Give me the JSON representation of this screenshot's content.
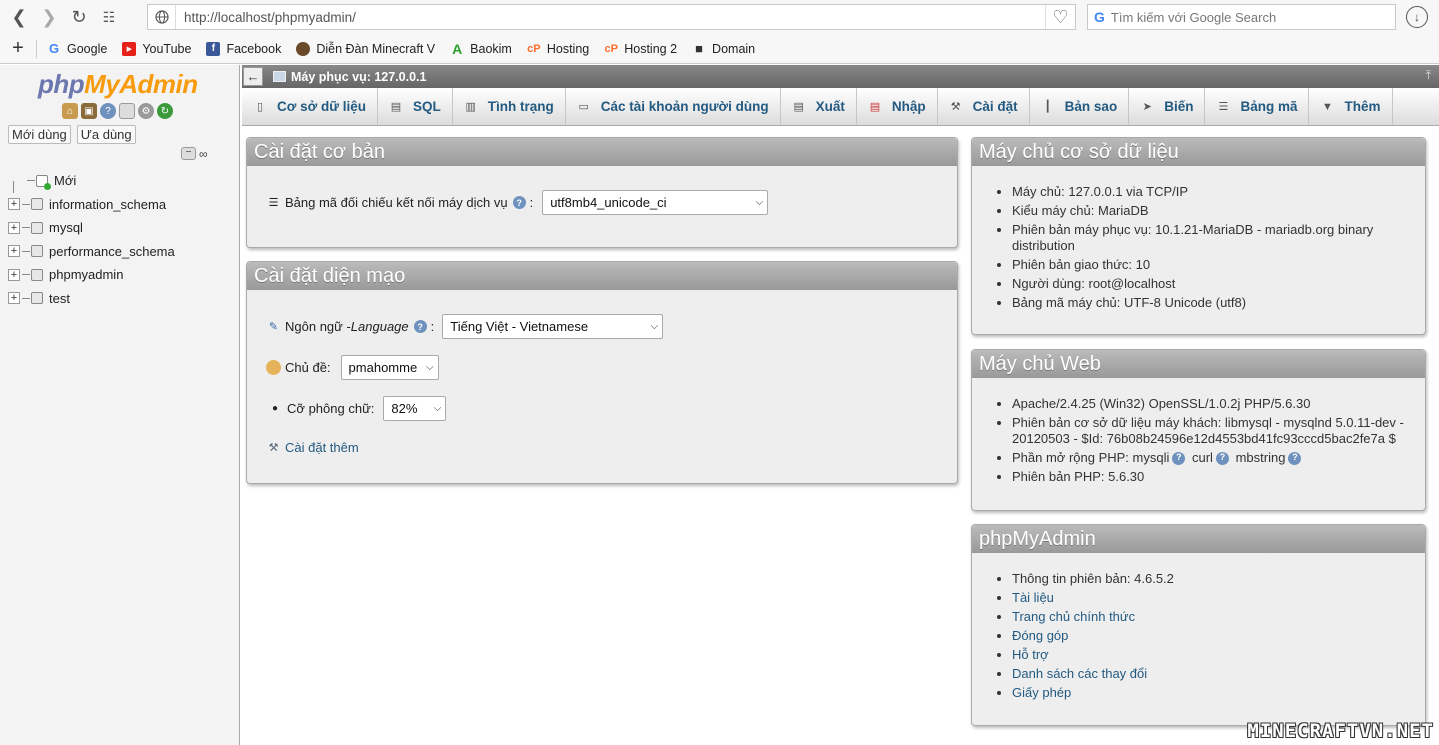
{
  "browser": {
    "url": "http://localhost/phpmyadmin/",
    "search_placeholder": "Tìm kiếm với Google Search",
    "bookmarks": [
      {
        "label": "Google",
        "icon": "google-icon",
        "color": "#4285f4"
      },
      {
        "label": "YouTube",
        "icon": "youtube-icon",
        "color": "#e62117"
      },
      {
        "label": "Facebook",
        "icon": "facebook-icon",
        "color": "#3b5998"
      },
      {
        "label": "Diễn Đàn Minecraft V",
        "icon": "minecraft-icon",
        "color": "#6b4a2b"
      },
      {
        "label": "Baokim",
        "icon": "baokim-icon",
        "color": "#2ca02c"
      },
      {
        "label": "Hosting",
        "icon": "cpanel-icon",
        "color": "#ff6c2c"
      },
      {
        "label": "Hosting 2",
        "icon": "cpanel-icon",
        "color": "#ff6c2c"
      },
      {
        "label": "Domain",
        "icon": "document-icon",
        "color": "#333333"
      }
    ]
  },
  "sidebar": {
    "logo_php": "php",
    "logo_myadmin": "MyAdmin",
    "tabs": [
      "Mới dùng",
      "Ưa dùng"
    ],
    "new_label": "Mới",
    "databases": [
      "information_schema",
      "mysql",
      "performance_schema",
      "phpmyadmin",
      "test"
    ]
  },
  "server_bar": {
    "label": "Máy phục vụ: 127.0.0.1"
  },
  "menu": [
    {
      "label": "Cơ sở dữ liệu",
      "icon": "database-icon"
    },
    {
      "label": "SQL",
      "icon": "sql-icon"
    },
    {
      "label": "Tình trạng",
      "icon": "status-icon"
    },
    {
      "label": "Các tài khoản người dùng",
      "icon": "users-icon"
    },
    {
      "label": "Xuất",
      "icon": "export-icon"
    },
    {
      "label": "Nhập",
      "icon": "import-icon"
    },
    {
      "label": "Cài đặt",
      "icon": "wrench-icon"
    },
    {
      "label": "Bản sao",
      "icon": "replication-icon"
    },
    {
      "label": "Biến",
      "icon": "variables-icon"
    },
    {
      "label": "Bảng mã",
      "icon": "charset-icon"
    },
    {
      "label": "Thêm",
      "icon": "chevron-down-icon"
    }
  ],
  "general_settings": {
    "title": "Cài đặt cơ bản",
    "collation_label": "Bảng mã đối chiếu kết nối máy dịch vụ",
    "collation_value": "utf8mb4_unicode_ci"
  },
  "appearance_settings": {
    "title": "Cài đặt diện mạo",
    "language_label": "Ngôn ngữ - ",
    "language_label_en": "Language",
    "language_value": "Tiếng Việt - Vietnamese",
    "theme_label": "Chủ đề:",
    "theme_value": "pmahomme",
    "fontsize_label": "Cỡ phông chữ:",
    "fontsize_value": "82%",
    "more_settings": "Cài đặt thêm"
  },
  "db_server": {
    "title": "Máy chủ cơ sở dữ liệu",
    "items": [
      "Máy chủ: 127.0.0.1 via TCP/IP",
      "Kiểu máy chủ: MariaDB",
      "Phiên bản máy phục vụ: 10.1.21-MariaDB - mariadb.org binary distribution",
      "Phiên bản giao thức: 10",
      "Người dùng: root@localhost",
      "Bảng mã máy chủ: UTF-8 Unicode (utf8)"
    ]
  },
  "web_server": {
    "title": "Máy chủ Web",
    "item1": "Apache/2.4.25 (Win32) OpenSSL/1.0.2j PHP/5.6.30",
    "item2": "Phiên bản cơ sở dữ liệu máy khách: libmysql - mysqlnd 5.0.11-dev - 20120503 - $Id: 76b08b24596e12d4553bd41fc93cccd5bac2fe7a $",
    "item3_prefix": "Phần mở rộng PHP: ",
    "ext1": "mysqli",
    "ext2": "curl",
    "ext3": "mbstring",
    "item4": "Phiên bản PHP: 5.6.30"
  },
  "pma_info": {
    "title": "phpMyAdmin",
    "version": "Thông tin phiên bản: 4.6.5.2",
    "links": [
      "Tài liệu",
      "Trang chủ chính thức",
      "Đóng góp",
      "Hỗ trợ",
      "Danh sách các thay đổi",
      "Giấy phép"
    ]
  },
  "watermark": "MINECRAFTVN.NET"
}
